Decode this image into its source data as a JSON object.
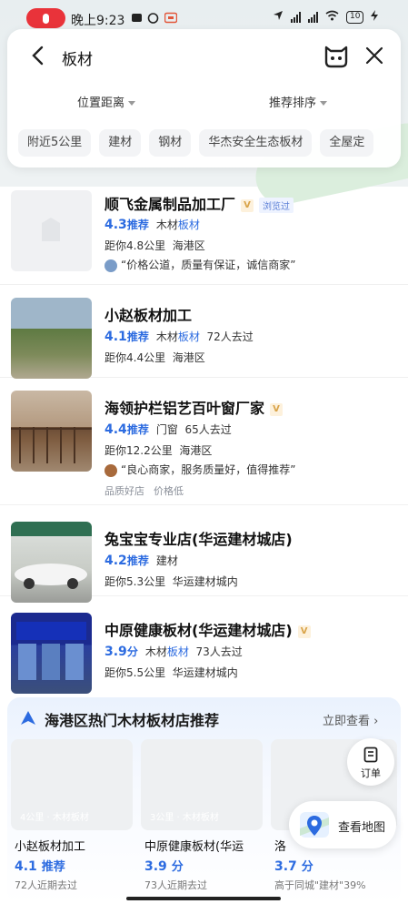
{
  "status_bar": {
    "time": "晚上9:23",
    "battery": "10"
  },
  "search": {
    "query": "板材"
  },
  "filters": [
    {
      "label": "位置距离"
    },
    {
      "label": "推荐排序"
    }
  ],
  "chips": [
    "附近5公里",
    "建材",
    "钢材",
    "华杰安全生态板材",
    "全屋定"
  ],
  "shops": [
    {
      "name": "顺飞金属制品加工厂",
      "vbadge": "V",
      "seen": "浏览过",
      "score": "4.3",
      "score_label": "推荐",
      "category": "木材",
      "category_tag": "板材",
      "distance": "距你4.8公里",
      "area": "海港区",
      "quote": "“价格公道，质量有保证，诚信商家”"
    },
    {
      "name": "小赵板材加工",
      "score": "4.1",
      "score_label": "推荐",
      "category": "木材",
      "category_tag": "板材",
      "visits": "72人去过",
      "distance": "距你4.4公里",
      "area": "海港区"
    },
    {
      "name": "海领护栏铝艺百叶窗厂家",
      "vbadge": "V",
      "score": "4.4",
      "score_label": "推荐",
      "category": "门窗",
      "visits": "65人去过",
      "distance": "距你12.2公里",
      "area": "海港区",
      "quote": "“良心商家，服务质量好，值得推荐”",
      "tags": [
        "品质好店",
        "价格低"
      ]
    },
    {
      "name": "兔宝宝专业店(华运建材城店)",
      "score": "4.2",
      "score_label": "推荐",
      "category": "建材",
      "distance": "距你5.3公里",
      "area": "华运建材城内"
    },
    {
      "name": "中原健康板材(华运建材城店)",
      "vbadge": "V",
      "score": "3.9",
      "score_label": "分",
      "category": "木材",
      "category_tag": "板材",
      "visits": "73人去过",
      "distance": "距你5.5公里",
      "area": "华运建材城内"
    }
  ],
  "recommend": {
    "title": "海港区热门木材板材店推荐",
    "more": "立即查看",
    "cards": [
      {
        "caption": "4公里 · 木材板材",
        "name": "小赵板材加工",
        "score": "4.1",
        "score_label": "推荐",
        "sub": "72人近期去过"
      },
      {
        "caption": "3公里 · 木材板材",
        "name": "中原健康板材(华运",
        "score": "3.9",
        "score_label": "分",
        "sub": "73人近期去过"
      },
      {
        "caption": "",
        "name": "洛",
        "score": "3.7",
        "score_label": "分",
        "sub": "高于同城\"建材\"39%"
      }
    ]
  },
  "floating": {
    "order": "订单",
    "map": "查看地图"
  },
  "colors": {
    "accent": "#2c6be0",
    "record": "#e9333a"
  }
}
